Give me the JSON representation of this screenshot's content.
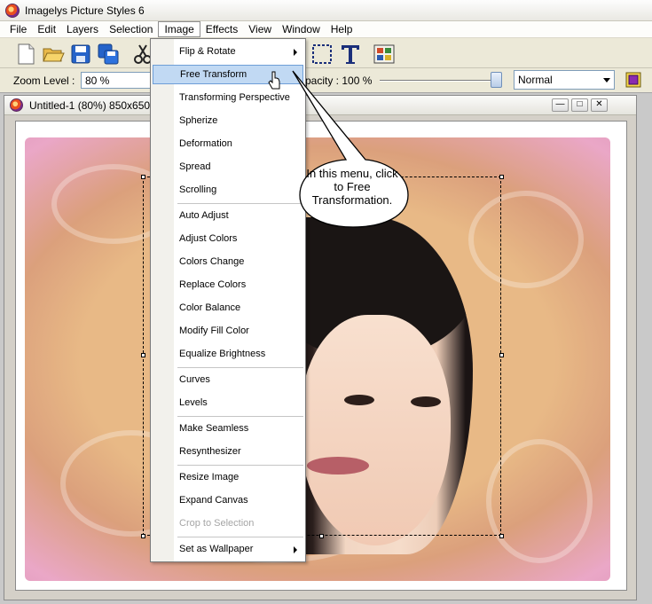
{
  "window": {
    "title": "Imagelys Picture Styles 6"
  },
  "menubar": {
    "items": [
      "File",
      "Edit",
      "Layers",
      "Selection",
      "Image",
      "Effects",
      "View",
      "Window",
      "Help"
    ],
    "active": "Image"
  },
  "optionbar": {
    "zoom_label": "Zoom Level :",
    "zoom_value": "80 %",
    "opacity_label": "pacity : 100 %",
    "opacity_value": 100,
    "blend_mode": "Normal"
  },
  "document": {
    "title": "Untitled-1 (80%) 850x650"
  },
  "image_menu": {
    "items": [
      {
        "label": "Flip & Rotate",
        "submenu": true
      },
      {
        "label": "Free Transform",
        "highlighted": true
      },
      {
        "label": "Transforming Perspective"
      },
      {
        "label": "Spherize"
      },
      {
        "label": "Deformation"
      },
      {
        "label": "Spread"
      },
      {
        "label": "Scrolling"
      },
      {
        "label": "Auto Adjust"
      },
      {
        "label": "Adjust Colors"
      },
      {
        "label": "Colors Change"
      },
      {
        "label": "Replace Colors"
      },
      {
        "label": "Color Balance"
      },
      {
        "label": "Modify Fill Color"
      },
      {
        "label": "Equalize Brightness"
      },
      {
        "label": "Curves"
      },
      {
        "label": "Levels"
      },
      {
        "label": "Make Seamless"
      },
      {
        "label": "Resynthesizer"
      },
      {
        "label": "Resize Image"
      },
      {
        "label": "Expand Canvas"
      },
      {
        "label": "Crop to Selection",
        "disabled": true
      },
      {
        "label": "Set as Wallpaper",
        "submenu": true
      }
    ]
  },
  "callout": {
    "text": "In this menu, click to Free Transformation."
  },
  "icons": {
    "toolbar": [
      "new-file-icon",
      "open-folder-icon",
      "save-icon",
      "save-all-icon",
      "cut-icon",
      "rect-select-icon",
      "text-tool-icon",
      "layers-palette-icon"
    ],
    "colors": {
      "menu_highlight": "#c1d9f3",
      "highlight_border": "#6e9ed7",
      "panel": "#ece9d8"
    }
  }
}
